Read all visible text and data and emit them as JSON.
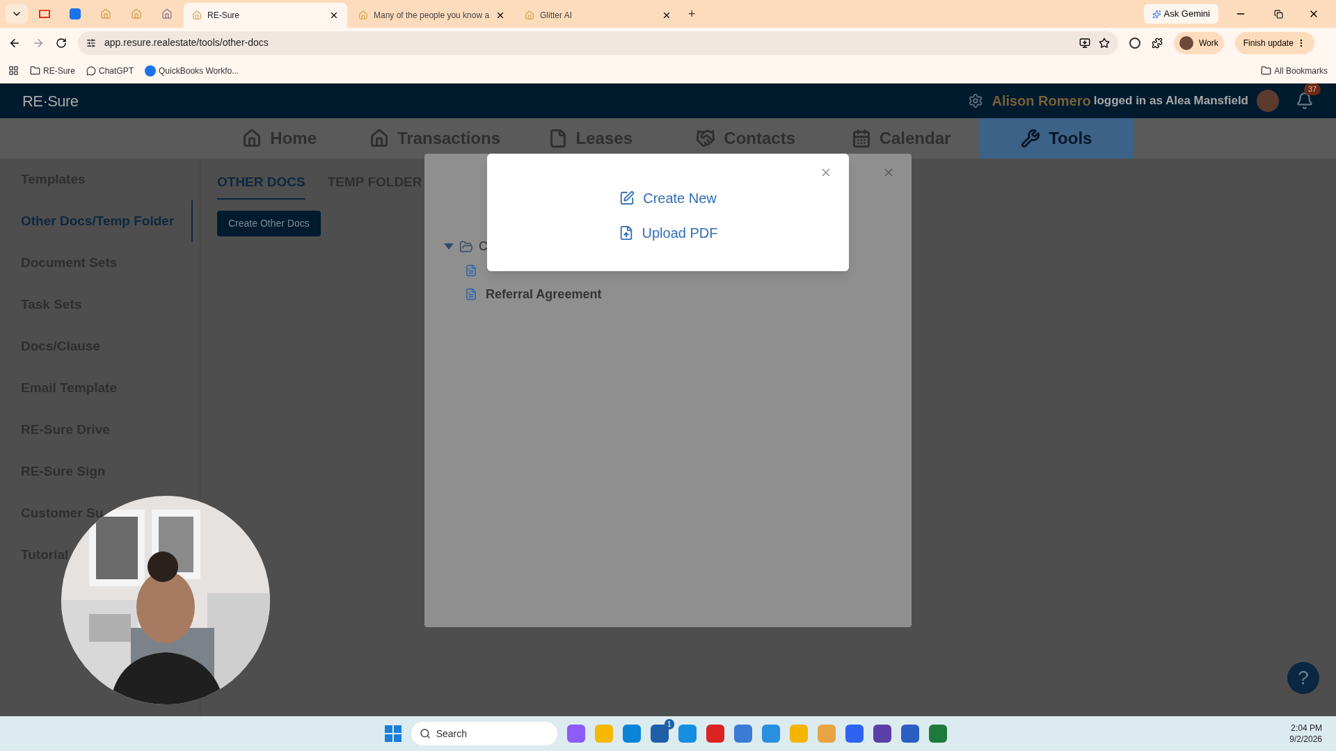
{
  "browser": {
    "tabs": [
      {
        "title": "RE-Sure",
        "selected": true
      },
      {
        "title": "Many of the people you know a",
        "selected": false
      },
      {
        "title": "Glitter AI",
        "selected": false
      }
    ],
    "new_tab": "+",
    "gemini": "Ask Gemini",
    "url": "app.resure.realestate/tools/other-docs",
    "profile": "Work",
    "update": "Finish update",
    "bookmarks": [
      "RE-Sure",
      "ChatGPT",
      "QuickBooks Workfo..."
    ],
    "all_bookmarks": "All Bookmarks"
  },
  "header": {
    "logo": "RE·Sure",
    "user": "Alison Romero",
    "logged_in": "logged in as Alea Mansfield",
    "notifications": "37"
  },
  "nav": [
    {
      "label": "Home",
      "selected": false
    },
    {
      "label": "Transactions",
      "selected": false
    },
    {
      "label": "Leases",
      "selected": false
    },
    {
      "label": "Contacts",
      "selected": false
    },
    {
      "label": "Calendar",
      "selected": false
    },
    {
      "label": "Tools",
      "selected": true
    }
  ],
  "sidebar": [
    {
      "label": "Templates",
      "selected": false
    },
    {
      "label": "Other Docs/Temp Folder",
      "selected": true
    },
    {
      "label": "Document Sets",
      "selected": false
    },
    {
      "label": "Task Sets",
      "selected": false
    },
    {
      "label": "Docs/Clause",
      "selected": false
    },
    {
      "label": "Email Template",
      "selected": false
    },
    {
      "label": "RE-Sure Drive",
      "selected": false
    },
    {
      "label": "RE-Sure Sign",
      "selected": false
    },
    {
      "label": "Customer Su",
      "selected": false
    },
    {
      "label": "Tutorial",
      "selected": false
    }
  ],
  "content_tabs": [
    {
      "label": "OTHER DOCS",
      "selected": true
    },
    {
      "label": "TEMP FOLDER",
      "selected": false
    }
  ],
  "create_button": "Create Other Docs",
  "tree": {
    "folder": "C",
    "expanded": true,
    "children": [
      {
        "kind": "document"
      },
      {
        "kind": "document",
        "name": "Referral Agreement"
      }
    ]
  },
  "dialog": {
    "options": [
      "Create New",
      "Upload PDF"
    ]
  },
  "help": "?",
  "taskbar": {
    "search": "Search",
    "badge": "1",
    "time": "2:04 PM",
    "date": "9/2/2026"
  }
}
